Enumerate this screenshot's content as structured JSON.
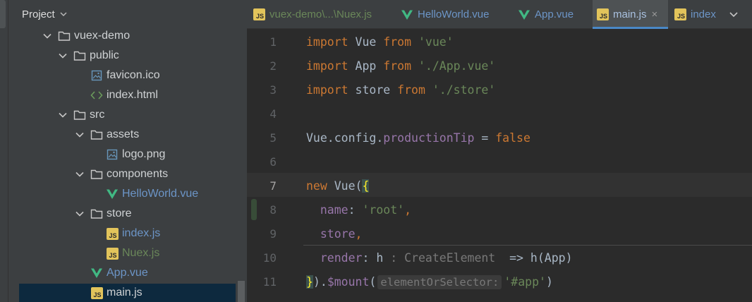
{
  "project_panel": {
    "title": "Project",
    "tree": [
      {
        "label": "vuex-demo",
        "kind": "folder",
        "depth": 0,
        "expanded": true
      },
      {
        "label": "public",
        "kind": "folder",
        "depth": 1,
        "expanded": true
      },
      {
        "label": "favicon.ico",
        "kind": "image",
        "depth": 2
      },
      {
        "label": "index.html",
        "kind": "html",
        "depth": 2
      },
      {
        "label": "src",
        "kind": "folder",
        "depth": 1,
        "expanded": true
      },
      {
        "label": "assets",
        "kind": "folder",
        "depth": 2,
        "expanded": true
      },
      {
        "label": "logo.png",
        "kind": "image",
        "depth": 3
      },
      {
        "label": "components",
        "kind": "folder",
        "depth": 2,
        "expanded": true
      },
      {
        "label": "HelloWorld.vue",
        "kind": "vue",
        "depth": 3
      },
      {
        "label": "store",
        "kind": "folder",
        "depth": 2,
        "expanded": true
      },
      {
        "label": "index.js",
        "kind": "js",
        "depth": 3
      },
      {
        "label": "Nuex.js",
        "kind": "js",
        "depth": 3
      },
      {
        "label": "App.vue",
        "kind": "vue",
        "depth": 2
      },
      {
        "label": "main.js",
        "kind": "js",
        "depth": 2,
        "selected": true
      }
    ]
  },
  "tabs": [
    {
      "label": "vuex-demo\\...\\Nuex.js",
      "icon": "js-file-icon",
      "color": "#6a8759"
    },
    {
      "label": "HelloWorld.vue",
      "icon": "vue-icon",
      "color": "#6c95c7"
    },
    {
      "label": "App.vue",
      "icon": "vue-icon",
      "color": "#6c95c7"
    },
    {
      "label": "main.js",
      "icon": "js-file-icon",
      "color": "#a9c1e0",
      "active": true,
      "close": "×"
    },
    {
      "label": "index",
      "icon": "js-file-icon",
      "color": "#6c95c7"
    }
  ],
  "editor": {
    "current_line": 7,
    "lines": [
      {
        "n": "1",
        "tokens": [
          [
            "kw",
            "import"
          ],
          [
            "p",
            " Vue "
          ],
          [
            "kw",
            "from"
          ],
          [
            "p",
            " "
          ],
          [
            "str",
            "'vue'"
          ]
        ]
      },
      {
        "n": "2",
        "tokens": [
          [
            "kw",
            "import"
          ],
          [
            "p",
            " App "
          ],
          [
            "kw",
            "from"
          ],
          [
            "p",
            " "
          ],
          [
            "str",
            "'./App.vue'"
          ]
        ]
      },
      {
        "n": "3",
        "tokens": [
          [
            "kw",
            "import"
          ],
          [
            "p",
            " store "
          ],
          [
            "kw",
            "from"
          ],
          [
            "p",
            " "
          ],
          [
            "str",
            "'./store'"
          ]
        ]
      },
      {
        "n": "4",
        "tokens": []
      },
      {
        "n": "5",
        "tokens": [
          [
            "p",
            "Vue."
          ],
          [
            "p",
            "config."
          ],
          [
            "prop",
            "productionTip"
          ],
          [
            "p",
            " = "
          ],
          [
            "kw",
            "false"
          ]
        ]
      },
      {
        "n": "6",
        "tokens": []
      },
      {
        "n": "7",
        "tokens": [
          [
            "kw",
            "new"
          ],
          [
            "p",
            " Vue("
          ],
          [
            "brace",
            "{"
          ]
        ]
      },
      {
        "n": "8",
        "tokens": [
          [
            "p",
            "  "
          ],
          [
            "prop",
            "name"
          ],
          [
            "p",
            ": "
          ],
          [
            "str",
            "'root'"
          ],
          [
            "kw",
            ","
          ]
        ]
      },
      {
        "n": "9",
        "tokens": [
          [
            "p",
            "  "
          ],
          [
            "prop",
            "store"
          ],
          [
            "kw",
            ","
          ]
        ]
      },
      {
        "n": "10",
        "tokens": [
          [
            "p",
            "  "
          ],
          [
            "prop",
            "render"
          ],
          [
            "p",
            ": h "
          ],
          [
            "type",
            ": CreateElement "
          ],
          [
            "p",
            " => h(App)"
          ]
        ]
      },
      {
        "n": "11",
        "tokens": [
          [
            "brace",
            "}"
          ],
          [
            "p",
            ")."
          ],
          [
            "prop",
            "$mount"
          ],
          [
            "p",
            "("
          ],
          [
            "hint",
            "elementOrSelector:"
          ],
          [
            "str",
            "'#app'"
          ],
          [
            "p",
            ")"
          ]
        ]
      }
    ]
  },
  "colors": {
    "keyword": "#cc7832",
    "string": "#6a8759",
    "property": "#9876aa",
    "plain": "#a9b7c6",
    "accent": "#4a88c7"
  }
}
